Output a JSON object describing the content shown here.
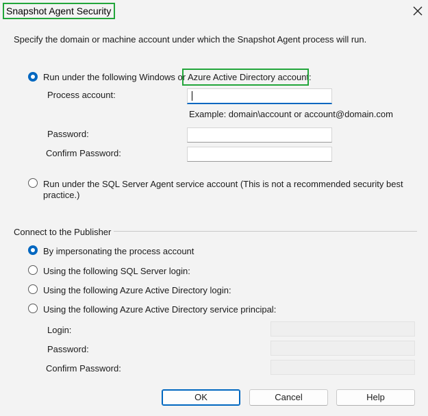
{
  "window": {
    "title": "Snapshot Agent Security"
  },
  "description": "Specify the domain or machine account under which the Snapshot Agent process will run.",
  "agent_account": {
    "windows_option_label_part1": "Run under the following Windows or ",
    "windows_option_label_part2": "Azure Active Directory account:",
    "windows_option_selected": true,
    "process_account_label": "Process account:",
    "process_account_value": "",
    "example_text": "Example: domain\\account or account@domain.com",
    "password_label": "Password:",
    "password_value": "",
    "confirm_password_label": "Confirm Password:",
    "confirm_password_value": "",
    "sql_agent_option_line1": "Run under the SQL Server Agent service account (This is not a recommended security best",
    "sql_agent_option_line2": "practice.)",
    "sql_agent_option_selected": false
  },
  "publisher": {
    "group_label": "Connect to the Publisher",
    "options": [
      {
        "label": "By impersonating the process account",
        "selected": true
      },
      {
        "label": "Using the following SQL Server login:",
        "selected": false
      },
      {
        "label": "Using the following Azure Active Directory login:",
        "selected": false
      },
      {
        "label": "Using the following Azure Active Directory service principal:",
        "selected": false
      }
    ],
    "login_label": "Login:",
    "password_label": "Password:",
    "confirm_password_label": "Confirm Password:"
  },
  "buttons": {
    "ok": "OK",
    "cancel": "Cancel",
    "help": "Help"
  },
  "colors": {
    "highlight": "#22a53a",
    "accent": "#0067c0"
  }
}
